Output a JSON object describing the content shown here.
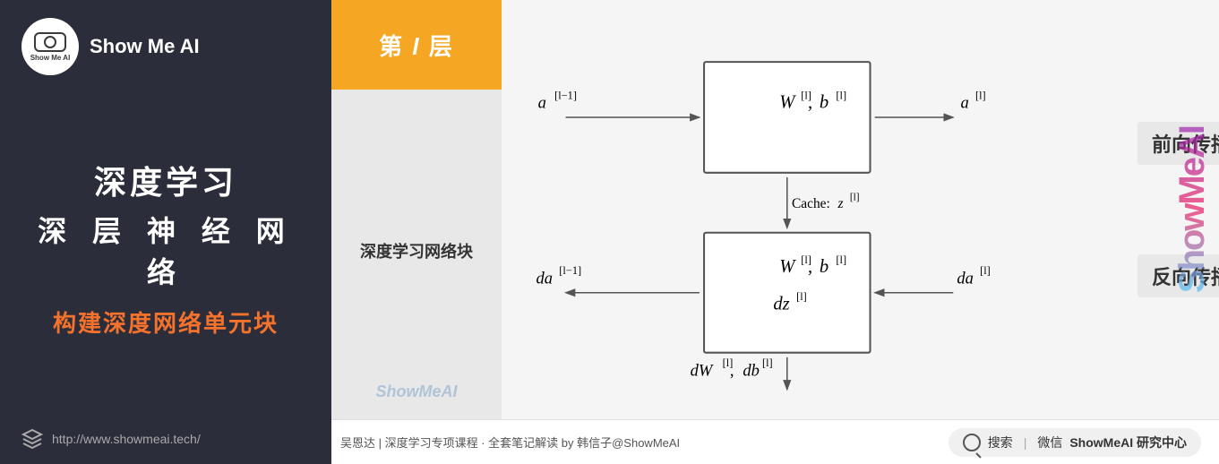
{
  "left": {
    "logo_text": "Show Me AI",
    "logo_subtext": "Show Me AI",
    "title_line1": "深度学习",
    "title_line2": "深 层 神 经 网 络",
    "subtitle": "构建深度网络单元块",
    "link": "http://www.showmeai.tech/"
  },
  "diagram": {
    "layer_header": "第 l 层",
    "layer_body_label": "深度学习网络块",
    "layer_watermark": "ShowMeAI",
    "forward_label": "前向传播",
    "backward_label": "反向传播"
  },
  "footer": {
    "left_text": "吴恩达 | 深度学习专项课程 · 全套笔记解读  by 韩信子@ShowMeAI",
    "search_label": "搜索",
    "wechat_label": "微信",
    "brand_label": "ShowMeAI 研究中心"
  },
  "watermark": "ShowMeAI"
}
